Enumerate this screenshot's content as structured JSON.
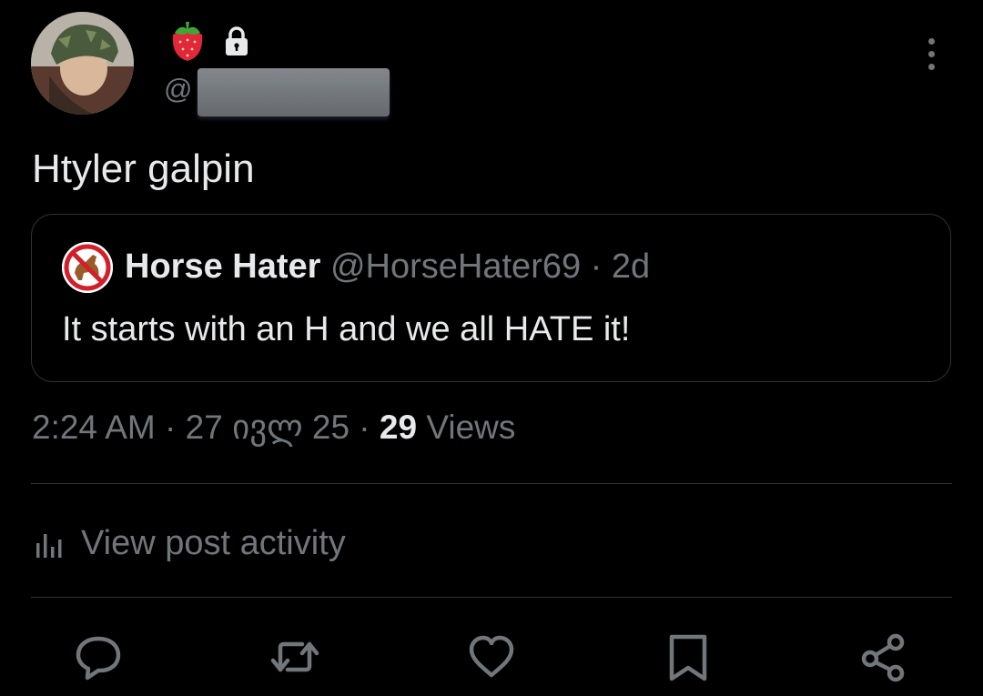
{
  "header": {
    "handle_prefix": "@",
    "icons": [
      "strawberry-icon",
      "lock-icon",
      "more-icon"
    ]
  },
  "tweet": {
    "text": "Htyler galpin"
  },
  "quote": {
    "display_name": "Horse Hater",
    "handle": "@HorseHater69",
    "separator": " · ",
    "age": "2d",
    "text": "It starts with an H and we all HATE it!"
  },
  "meta": {
    "time": "2:24 AM",
    "sep1": " · ",
    "date": "27 ივლ 25",
    "sep2": " · ",
    "views_count": "29",
    "views_label": " Views"
  },
  "activity": {
    "label": "View post activity"
  },
  "actions": {
    "icons": [
      "reply-icon",
      "repost-icon",
      "like-icon",
      "bookmark-icon",
      "share-icon"
    ]
  },
  "colors": {
    "background": "#000000",
    "text": "#e7e9ea",
    "muted": "#71767b",
    "border": "#2f3336"
  }
}
